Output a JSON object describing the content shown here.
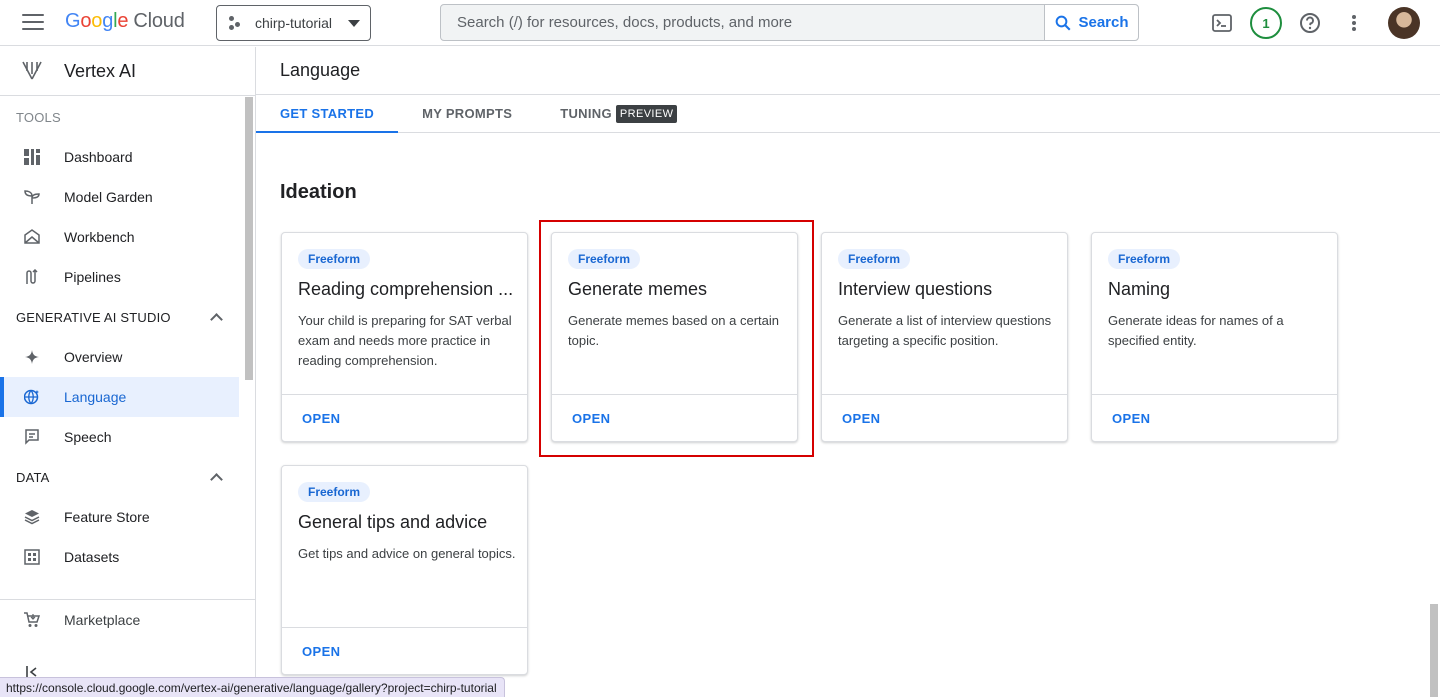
{
  "topbar": {
    "logo_google": "Google",
    "logo_cloud": "Cloud",
    "project_name": "chirp-tutorial",
    "search_placeholder": "Search (/) for resources, docs, products, and more",
    "search_button": "Search",
    "notification_count": "1"
  },
  "sidebar": {
    "product_title": "Vertex AI",
    "sections": [
      {
        "label": "TOOLS",
        "items": [
          "Dashboard",
          "Model Garden",
          "Workbench",
          "Pipelines"
        ]
      },
      {
        "label": "GENERATIVE AI STUDIO",
        "items": [
          "Overview",
          "Language",
          "Speech"
        ]
      },
      {
        "label": "DATA",
        "items": [
          "Feature Store",
          "Datasets"
        ]
      }
    ],
    "active_item": "Language",
    "marketplace": "Marketplace"
  },
  "main": {
    "page_title": "Language",
    "tabs": [
      {
        "label": "GET STARTED",
        "active": true
      },
      {
        "label": "MY PROMPTS",
        "active": false
      },
      {
        "label": "TUNING",
        "badge": "PREVIEW",
        "active": false
      }
    ],
    "section_title": "Ideation",
    "cards": [
      {
        "chip": "Freeform",
        "title": "Reading comprehension ...",
        "description": "Your child is preparing for SAT verbal exam and needs more practice in reading comprehension.",
        "action": "OPEN"
      },
      {
        "chip": "Freeform",
        "title": "Generate memes",
        "description": "Generate memes based on a certain topic.",
        "action": "OPEN",
        "highlighted": true
      },
      {
        "chip": "Freeform",
        "title": "Interview questions",
        "description": "Generate a list of interview questions targeting a specific position.",
        "action": "OPEN"
      },
      {
        "chip": "Freeform",
        "title": "Naming",
        "description": "Generate ideas for names of a specified entity.",
        "action": "OPEN"
      },
      {
        "chip": "Freeform",
        "title": "General tips and advice",
        "description": "Get tips and advice on general topics.",
        "action": "OPEN"
      }
    ]
  },
  "status_url": "https://console.cloud.google.com/vertex-ai/generative/language/gallery?project=chirp-tutorial",
  "colors": {
    "accent": "#1a73e8",
    "highlight": "#d50000",
    "chip_bg": "#e8f0fe"
  }
}
